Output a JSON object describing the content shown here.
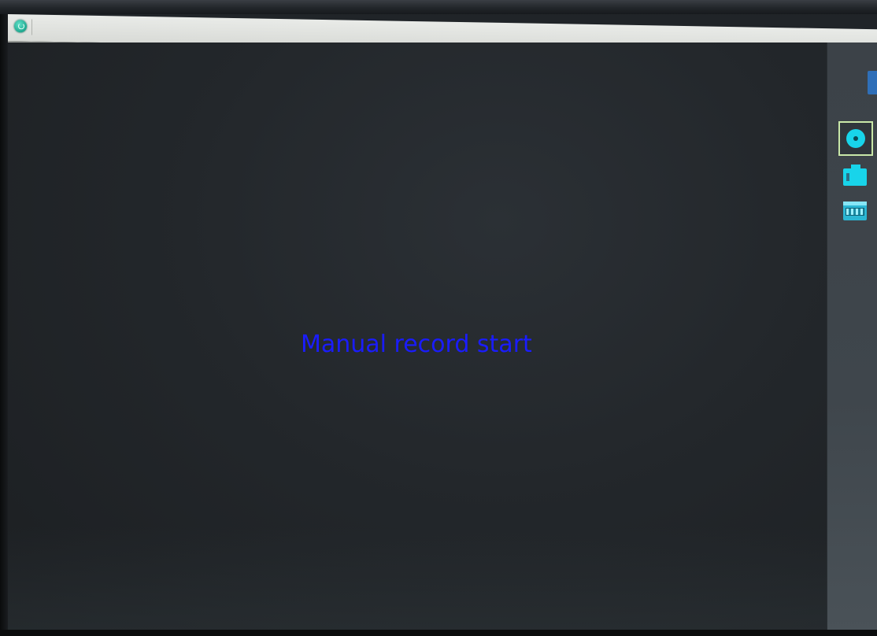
{
  "screen": {
    "status_message": "Manual record start"
  },
  "toolbar": {
    "tools": [
      {
        "id": "record",
        "icon": "record-icon",
        "active": true
      },
      {
        "id": "snapshot",
        "icon": "camera-icon",
        "active": false
      },
      {
        "id": "playback",
        "icon": "playback-icon",
        "active": false
      }
    ]
  },
  "colors": {
    "status_text": "#1a1cff",
    "tool_accent": "#18d4ea",
    "active_border": "#c9e7a8",
    "power_button": "#1fa88f",
    "side_tab": "#2f6fb8"
  }
}
